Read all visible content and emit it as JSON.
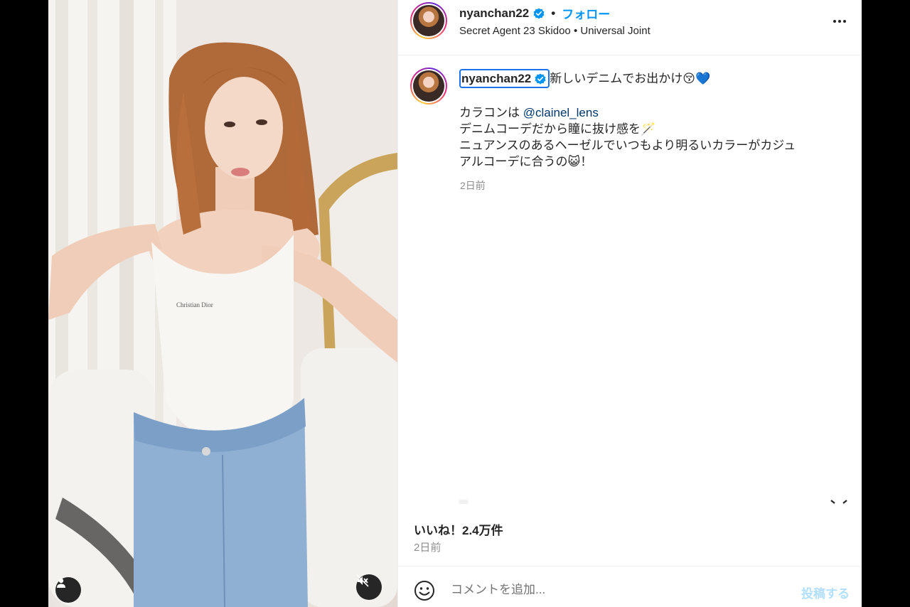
{
  "header": {
    "username": "nyanchan22",
    "separator": "•",
    "follow_label": "フォロー",
    "audio": "Secret Agent 23 Skidoo • Universal Joint"
  },
  "caption": {
    "username": "nyanchan22",
    "title": "新しいデニムでお出かけ😚💙",
    "line1_prefix": "カラコンは ",
    "mention": "@clainel_lens",
    "line2": "デニムコーデだから瞳に抜け感を🪄",
    "line3": "ニュアンスのあるヘーゼルでいつもより明るいカラーがカジュ",
    "line4": "アルコーデに合うの😺！",
    "time": "2日前"
  },
  "stats": {
    "likes": "いいね！2.4万件",
    "time": "2日前"
  },
  "comment": {
    "placeholder": "コメントを追加...",
    "post_label": "投稿する"
  },
  "icons": {
    "verified": "verified-badge-icon",
    "more": "more-options-icon",
    "tag": "user-tag-icon",
    "mute": "muted-speaker-icon",
    "emoji": "emoji-smile-icon"
  },
  "colors": {
    "accent": "#0095f6",
    "verified": "#0095f6",
    "mention": "#00376b",
    "muted_text": "#8e8e8e",
    "post_disabled": "#b2dffc",
    "focus_outline": "#1a73e8"
  }
}
